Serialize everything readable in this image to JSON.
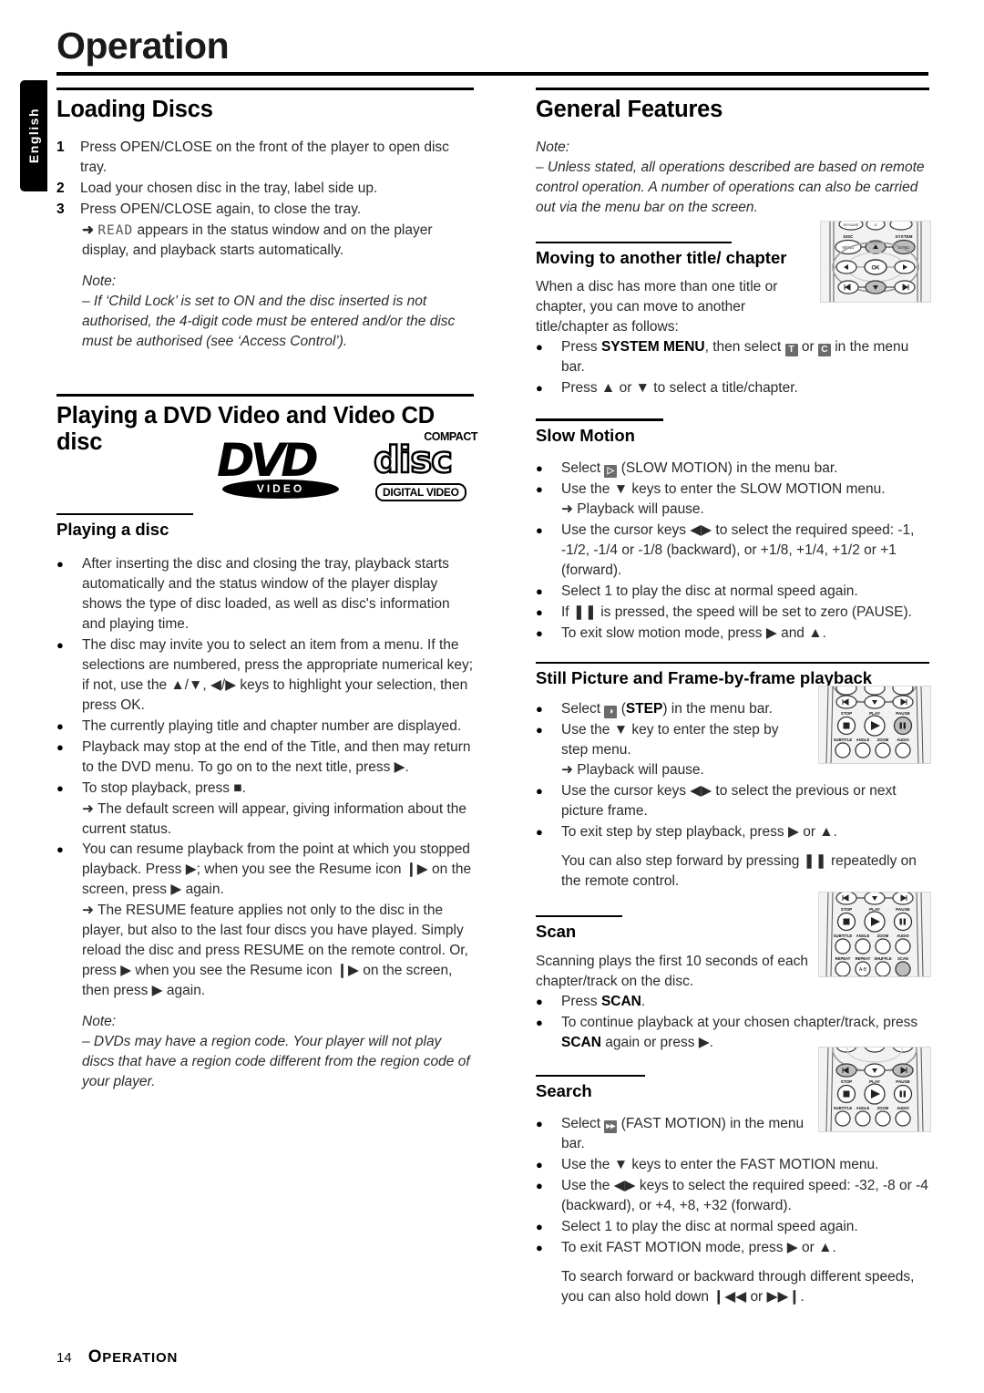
{
  "language_tab": "English",
  "chapter_title": "Operation",
  "footer": {
    "page_number": "14",
    "section_initial": "O",
    "section_rest": "PERATION"
  },
  "left_column": {
    "heading": "Loading Discs",
    "steps": [
      {
        "num": "1",
        "text": "Press OPEN/CLOSE on the front of the player to open disc tray."
      },
      {
        "num": "2",
        "text": "Load your chosen disc in the tray, label side up."
      },
      {
        "num": "3",
        "text": "Press OPEN/CLOSE again, to close the tray."
      }
    ],
    "step3_result_prefix": "appears in the status window and on the player display, and playback starts automatically.",
    "step3_lcd": "READ",
    "note1_label": "Note:",
    "note1_text": "–  If ‘Child Lock’ is set to ON and the disc inserted is not authorised, the 4-digit code must be entered and/or the disc must be authorised (see ‘Access Control’).",
    "heading2": "Playing a DVD Video and Video CD disc",
    "subheading": "Playing a disc",
    "bullets": [
      "After inserting the disc and closing the tray, playback starts automatically and the status window of the player display shows the type of disc loaded, as well as disc's information and playing time.",
      "The disc may invite you to select an item from a menu. If the selections are numbered, press the appropriate numerical key; if not, use the ▲/▼, ◀/▶ keys to highlight your selection, then press OK.",
      "The currently playing title and chapter number are displayed.",
      "Playback may stop at the end of the Title, and then may return to the DVD menu. To go on to the next title, press ▶.",
      "To stop playback, press ■."
    ],
    "stop_result": "➜ The default screen will appear, giving information about the current status.",
    "resume_bullet": "You can resume playback from the point at which you stopped playback. Press ▶; when you see the Resume icon ❙▶ on the screen, press ▶ again.",
    "resume_result": "➜ The RESUME feature applies not only to the disc in the player, but also to the last four discs you have played. Simply reload the disc and press RESUME on the remote control. Or, press ▶ when you see the Resume icon ❙▶ on the screen, then press ▶ again.",
    "resume_bold": "RESUME",
    "note2_label": "Note:",
    "note2_text": "–  DVDs may have a region code. Your player will not play discs that have a region code different from the region code of your player.",
    "logos": {
      "dvd_word": "DVD",
      "dvd_video": "VIDEO",
      "cd_compact": "COMPACT",
      "cd_disc": "disc",
      "cd_digital": "DIGITAL VIDEO"
    }
  },
  "right_column": {
    "heading": "General Features",
    "note_label": "Note:",
    "note_text": "–  Unless stated, all operations described are based on remote control operation. A number of operations can also be carried out via the menu bar on the screen.",
    "sections": [
      {
        "title": "Moving to another title/ chapter",
        "intro": "When a disc has more than one title or chapter, you can move to another title/chapter as follows:",
        "bullets": [
          "Press SYSTEM MENU, then select ▣ or ▣ in the menu bar.",
          "Press ▲ or ▼ to select a title/chapter."
        ],
        "bold_term": "SYSTEM MENU"
      },
      {
        "title": "Slow Motion",
        "bullets": [
          "Select ▣ (SLOW MOTION) in the menu bar.",
          "Use the ▼ keys to enter the SLOW MOTION menu.",
          "Use the cursor keys ◀▶ to select the required speed: -1, -1/2, -1/4 or -1/8 (backward), or +1/8, +1/4, +1/2 or +1 (forward).",
          "Select 1 to play the disc at normal speed again.",
          "If ❚❚ is pressed, the speed will be set to zero (PAUSE).",
          "To exit slow motion mode, press ▶ and ▲."
        ],
        "pause_result": "➜ Playback will pause."
      },
      {
        "title": "Still Picture and Frame-by-frame playback",
        "bullets": [
          "Select ▣ (STEP) in the menu bar.",
          "Use the ▼ key to enter the step by step menu.",
          "Use the cursor keys ◀▶ to select the previous or next picture frame.",
          "To exit step by step playback, press ▶ or ▲."
        ],
        "bold_term": "STEP",
        "pause_result": "➜ Playback will pause.",
        "closing": "You can also step forward by pressing ❚❚ repeatedly on the remote control."
      },
      {
        "title": "Scan",
        "intro": "Scanning plays the first 10 seconds of each chapter/track on the disc.",
        "bullets": [
          "Press SCAN.",
          "To continue playback at your chosen chapter/track, press SCAN again or press ▶."
        ],
        "bold_term": "SCAN"
      },
      {
        "title": "Search",
        "bullets": [
          "Select ▣ (FAST MOTION) in the menu bar.",
          "Use the ▼ keys to enter the FAST MOTION menu.",
          "Use the ◀▶ keys to select the required speed: -32, -8 or -4 (backward), or +4, +8, +32 (forward).",
          "Select 1 to play the disc at normal speed again.",
          "To exit FAST MOTION mode, press ▶ or ▲."
        ],
        "closing": "To search forward or backward through different speeds, you can also hold down ❙◀◀ or ▶▶❙."
      }
    ]
  },
  "remote_labels": {
    "disc_menu": "DISC MENU",
    "system_menu": "SYSTEM MENU",
    "ok": "OK",
    "stop": "STOP",
    "play": "PLAY",
    "pause": "PAUSE",
    "subtitle": "SUBTITLE",
    "angle": "ANGLE",
    "zoom": "ZOOM",
    "audio": "AUDIO",
    "repeat": "REPEAT",
    "repeat_ab": "REPEAT",
    "shuffle": "SHUFFLE",
    "scan": "SCAN"
  },
  "colors": {
    "text": "#2b2b2b",
    "heading": "#000000",
    "tab_bg": "#000000",
    "badge": "#6b6b6b",
    "remote_bg": "#f2f2f2"
  }
}
